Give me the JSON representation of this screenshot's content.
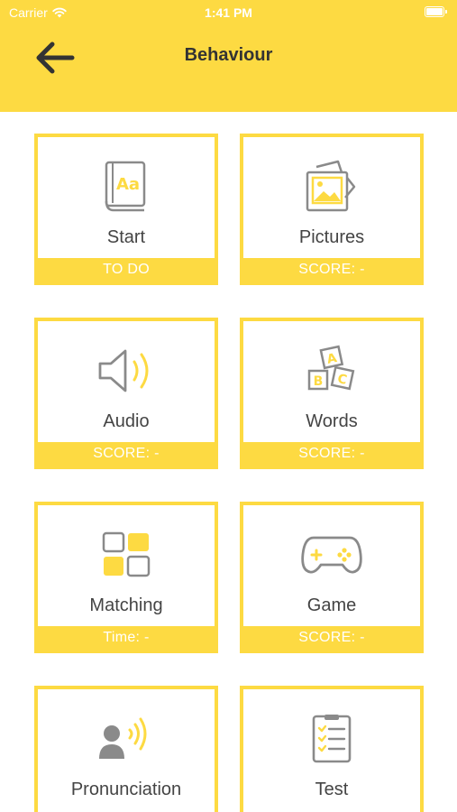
{
  "status": {
    "carrier": "Carrier",
    "time": "1:41 PM"
  },
  "header": {
    "title": "Behaviour"
  },
  "colors": {
    "accent": "#FDDA42",
    "icon_gray": "#8A8A8A",
    "text": "#444444"
  },
  "cards": [
    {
      "label": "Start",
      "footer": "TO DO",
      "icon": "book-icon"
    },
    {
      "label": "Pictures",
      "footer": "SCORE: -",
      "icon": "pictures-icon"
    },
    {
      "label": "Audio",
      "footer": "SCORE: -",
      "icon": "speaker-icon"
    },
    {
      "label": "Words",
      "footer": "SCORE: -",
      "icon": "abc-blocks-icon"
    },
    {
      "label": "Matching",
      "footer": "Time: -",
      "icon": "matching-grid-icon"
    },
    {
      "label": "Game",
      "footer": "SCORE: -",
      "icon": "gamepad-icon"
    },
    {
      "label": "Pronunciation",
      "footer": "",
      "icon": "pronunciation-icon"
    },
    {
      "label": "Test",
      "footer": "",
      "icon": "checklist-icon"
    }
  ]
}
